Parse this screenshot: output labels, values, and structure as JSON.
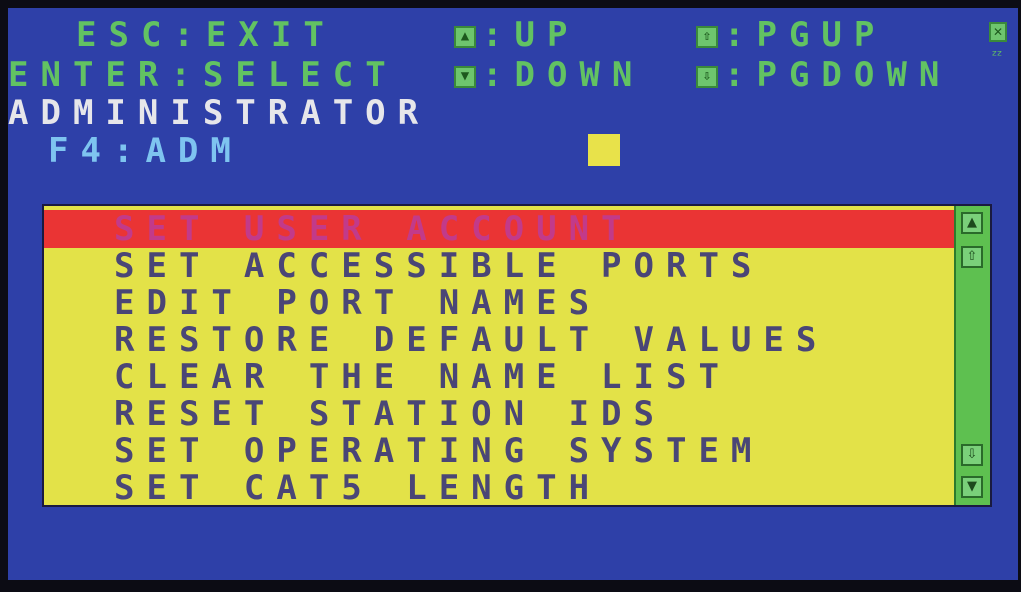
{
  "header": {
    "esc_key": "ESC",
    "esc_action": "EXIT",
    "enter_key": "ENTER",
    "enter_action": "SELECT",
    "up_label": "UP",
    "down_label": "DOWN",
    "pgup_label": "PGUP",
    "pgdown_label": "PGDOWN",
    "separator": ":",
    "role": "ADMINISTRATOR",
    "f4_key": "F4",
    "f4_action": "ADM",
    "sleep_glyph": "ᶻᶻ"
  },
  "menu": {
    "items": [
      "SET USER ACCOUNT",
      "SET ACCESSIBLE PORTS",
      "EDIT PORT NAMES",
      "RESTORE DEFAULT VALUES",
      "CLEAR THE NAME LIST",
      "RESET STATION IDS",
      "SET OPERATING SYSTEM",
      "SET CAT5 LENGTH"
    ],
    "selected_index": 0
  },
  "colors": {
    "background": "#2e40a8",
    "menu_bg": "#e3e248",
    "selection": "#ea3434",
    "hint_text": "#62c262",
    "scrollbar": "#5ec050"
  },
  "icons": {
    "up": "up-arrow-icon",
    "down": "down-arrow-icon",
    "pgup": "page-up-icon",
    "pgdown": "page-down-icon",
    "close": "close-icon",
    "sleep": "sleep-icon"
  }
}
